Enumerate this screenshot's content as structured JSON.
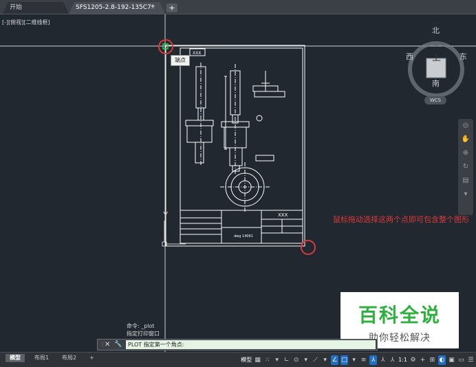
{
  "tabs": {
    "start": "开始",
    "file": "SFS1205-2.8-192-135C7*",
    "close": "×",
    "new": "+"
  },
  "viewport": {
    "label": "[-][俯视][二维线框]"
  },
  "viewcube": {
    "north": "北",
    "south": "南",
    "east": "东",
    "west": "西",
    "face": "上",
    "wcs": "WCS"
  },
  "tooltip": {
    "text": "端点"
  },
  "drawing": {
    "title_code": "XXX",
    "block_code": "XXX",
    "figure_no": "dwg 14061"
  },
  "axes": {
    "y_label": "Y"
  },
  "annotation": {
    "text": "鼠标拖动选择这两个点即可包含整个图形"
  },
  "watermark": {
    "title": "百科全说",
    "subtitle": "助你轻松解决"
  },
  "command": {
    "history_1": "命令: _plot",
    "history_2": "指定打印窗口",
    "prompt": "PLOT 指定第一个角点:"
  },
  "statusbar": {
    "layout_tabs": [
      "模型",
      "布局1",
      "布局2"
    ],
    "add": "+",
    "model": "模型",
    "scale": "1:1"
  },
  "colors": {
    "background": "#212830",
    "annotation": "#d93a3a",
    "watermark_green": "#2db03e"
  }
}
